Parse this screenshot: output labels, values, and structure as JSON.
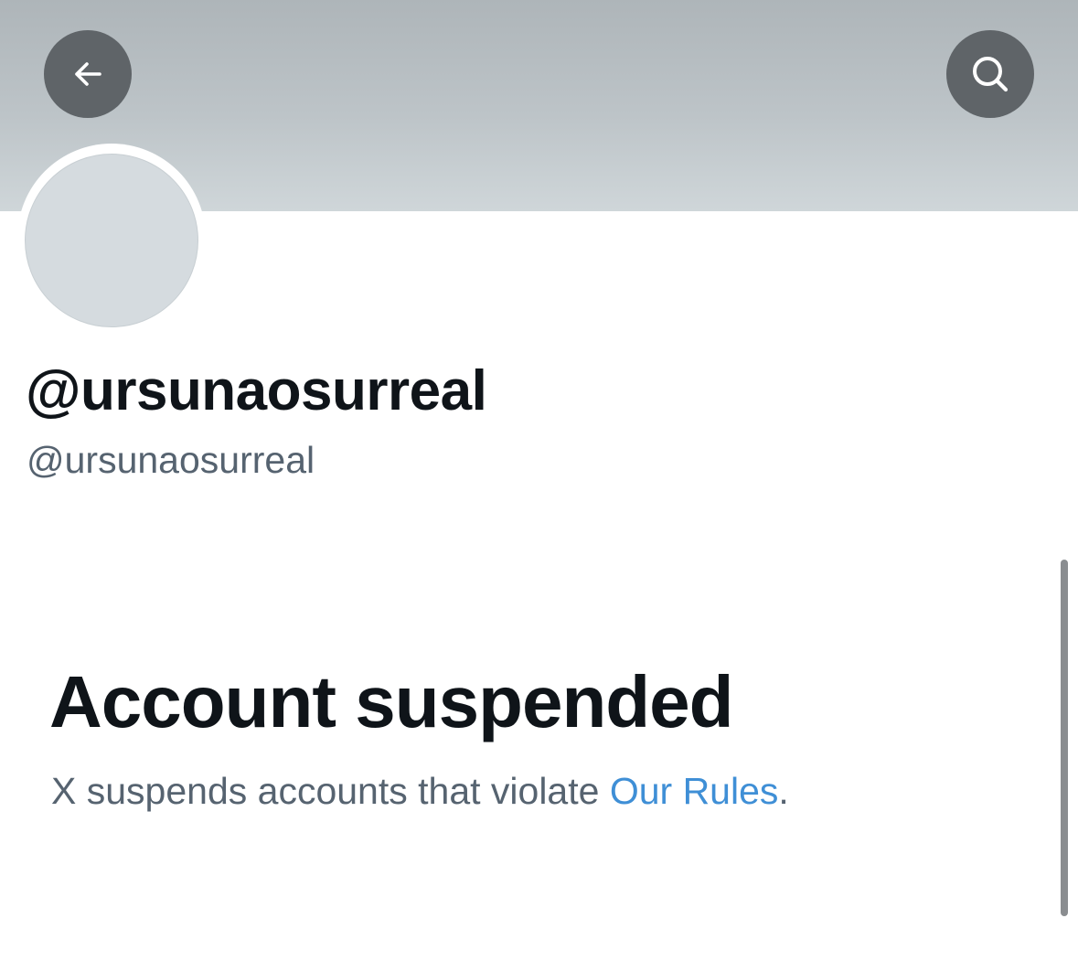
{
  "header": {
    "back_icon": "arrow-left-icon",
    "search_icon": "search-icon",
    "button_color": "#5f6468",
    "banner_color": "#bdc4c8"
  },
  "profile": {
    "display_name": "@ursunaosurreal",
    "handle": "@ursunaosurreal",
    "avatar_color": "#d5dbdf"
  },
  "suspension": {
    "title": "Account suspended",
    "message_prefix": "X suspends accounts that violate ",
    "rules_link_text": "Our Rules",
    "message_suffix": ".",
    "link_color": "#3f8fd6"
  }
}
